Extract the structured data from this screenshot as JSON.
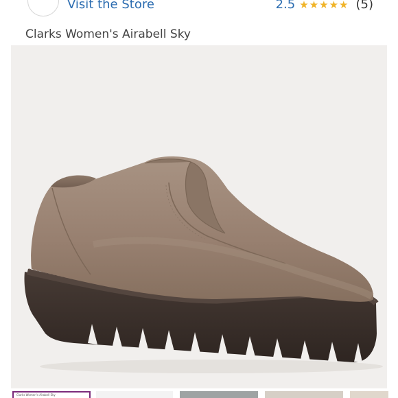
{
  "header": {
    "visit_store_label": "Visit the Store",
    "rating_value": "2.5",
    "rating_stars": "★★★★★",
    "review_count": "(5)"
  },
  "product": {
    "title": "Clarks Women's Airabell Sky"
  },
  "thumbnails": {
    "first_label": "Clarks Women's Airabell Sky"
  },
  "colors": {
    "link": "#2b6cb0",
    "star": "#f0b429",
    "photo_background": "#f1efed",
    "suede": "#9a8474",
    "sole": "#3b302b",
    "thumb_selected_border": "#7b2b7b"
  }
}
